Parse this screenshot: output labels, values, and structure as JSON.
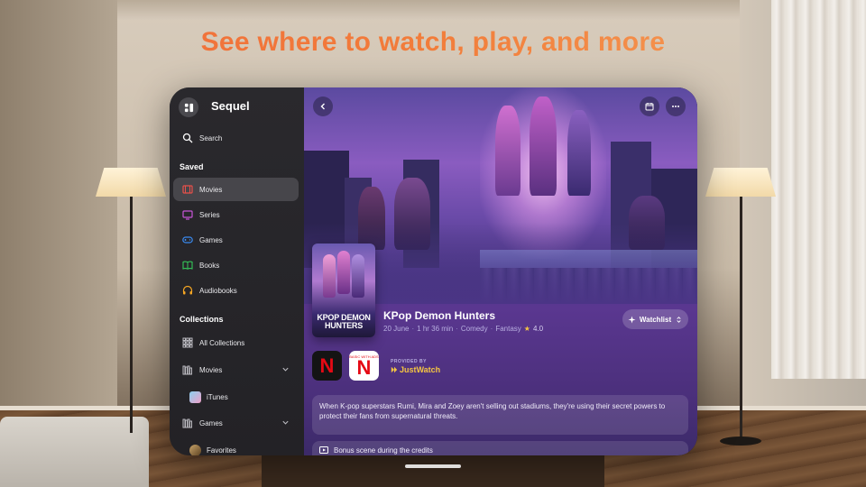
{
  "headline": "See where to watch, play, and more",
  "colors": {
    "accent": "#f07a3c",
    "sidebar_bg": "#2a292d",
    "main_bg": "#4b3586",
    "rating_star": "#f5c542",
    "netflix_red": "#e50914"
  },
  "app": {
    "name": "Sequel",
    "logo_icon": "sequel-logo-icon"
  },
  "sidebar": {
    "search_label": "Search",
    "saved_header": "Saved",
    "saved_items": [
      {
        "label": "Movies",
        "icon": "film-icon",
        "color": "#e8504a",
        "active": true
      },
      {
        "label": "Series",
        "icon": "tv-icon",
        "color": "#c855d8",
        "active": false
      },
      {
        "label": "Games",
        "icon": "gamepad-icon",
        "color": "#3a8af0",
        "active": false
      },
      {
        "label": "Books",
        "icon": "book-icon",
        "color": "#34c759",
        "active": false
      },
      {
        "label": "Audiobooks",
        "icon": "headphones-icon",
        "color": "#f5a623",
        "active": false
      }
    ],
    "collections_header": "Collections",
    "collection_items": [
      {
        "label": "All Collections",
        "icon": "grid-icon"
      },
      {
        "label": "Movies",
        "icon": "shelf-icon",
        "expandable": true
      },
      {
        "label": "iTunes",
        "icon": "itunes-thumb",
        "indent": true
      },
      {
        "label": "Games",
        "icon": "shelf-icon",
        "expandable": true
      },
      {
        "label": "Favorites",
        "icon": "favorites-thumb",
        "indent": true
      }
    ]
  },
  "movie": {
    "title": "KPop Demon Hunters",
    "poster_title": "KPOP DEMON HUNTERS",
    "date": "20 June",
    "duration": "1 hr 36 min",
    "genres": [
      "Comedy",
      "Fantasy"
    ],
    "rating": "4.0",
    "watchlist_label": "Watchlist",
    "providers": [
      {
        "name": "Netflix",
        "letter": "N"
      },
      {
        "name": "Netflix with Ads",
        "letter": "N",
        "sub": "BASIC WITH ADS"
      }
    ],
    "provided_by_label": "PROVIDED BY",
    "provided_by_brand": "JustWatch",
    "synopsis": "When K-pop superstars Rumi, Mira and Zoey aren't selling out stadiums, they're using their secret powers to protect their fans from supernatural threats.",
    "bonus_label": "Bonus scene during the credits"
  },
  "toolbar": {
    "back_icon": "chevron-left-icon",
    "calendar_icon": "calendar-icon",
    "more_icon": "ellipsis-icon"
  }
}
